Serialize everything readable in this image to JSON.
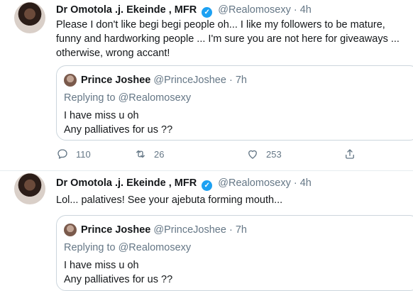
{
  "tweets": [
    {
      "author_name": "Dr Omotola .j. Ekeinde , MFR",
      "handle": "@Realomosexy",
      "dot": "·",
      "time": "4h",
      "text": "Please I don't like begi begi people oh... I like my followers to be mature, funny and hardworking people ... I'm sure you are not here for giveaways ... otherwise, wrong accant!",
      "quote": {
        "author_name": "Prince Joshee",
        "handle": "@PrinceJoshee",
        "dot": "·",
        "time": "7h",
        "replying_prefix": "Replying to",
        "replying_handle": "@Realomosexy",
        "line1": "I have miss u oh",
        "line2": "Any palliatives for us ??"
      },
      "actions": {
        "replies": "110",
        "retweets": "26",
        "likes": "253"
      }
    },
    {
      "author_name": "Dr Omotola .j. Ekeinde , MFR",
      "handle": "@Realomosexy",
      "dot": "·",
      "time": "4h",
      "text": "Lol... palatives! See your ajebuta forming mouth...",
      "quote": {
        "author_name": "Prince Joshee",
        "handle": "@PrinceJoshee",
        "dot": "·",
        "time": "7h",
        "replying_prefix": "Replying to",
        "replying_handle": "@Realomosexy",
        "line1": "I have miss u oh",
        "line2": "Any palliatives for us ??"
      }
    }
  ],
  "icons": {
    "verified": "verified-badge-icon",
    "reply": "reply-icon",
    "retweet": "retweet-icon",
    "like": "heart-icon",
    "share": "share-icon"
  },
  "colors": {
    "verified": "#1da1f2",
    "secondary_text": "#657786",
    "border": "#ccd6dd"
  }
}
